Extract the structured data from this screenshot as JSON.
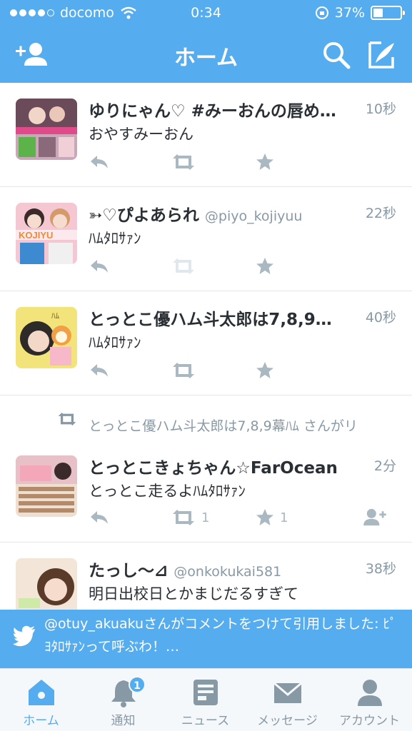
{
  "status_bar": {
    "carrier": "docomo",
    "time": "0:34",
    "battery": "37%",
    "battery_level": 0.37
  },
  "nav": {
    "title": "ホーム",
    "left_icon": "add-user-icon",
    "right_icons": [
      "search-icon",
      "compose-icon"
    ]
  },
  "tweets": [
    {
      "name": "ゆりにゃん♡ #みーおんの唇め…",
      "handle": "",
      "time": "10秒",
      "text": "おやすみーおん",
      "retweet_count": "",
      "favorite_count": ""
    },
    {
      "name": "➳♡ぴよあられ",
      "handle": "@piyo_kojiyuu",
      "time": "22秒",
      "text": "ﾊﾑﾀﾛｻｧﾝ",
      "retweet_count": "",
      "favorite_count": ""
    },
    {
      "name": "とっとこ優ハム斗太郎は7,8,9…",
      "handle": "",
      "time": "40秒",
      "text": "ﾊﾑﾀﾛｻｧﾝ",
      "retweet_count": "",
      "favorite_count": ""
    },
    {
      "retweeted_by": "とっとこ優ハム斗太郎は7,8,9幕ﾊﾑ さんがリ",
      "name": "とっとこきょちゃん☆FarOcean",
      "handle": "",
      "time": "2分",
      "text": "とっとこ走るよﾊﾑﾀﾛｻｧﾝ",
      "retweet_count": "1",
      "favorite_count": "1"
    },
    {
      "name": "たっし〜⊿",
      "handle": "@onkokukai581",
      "time": "38秒",
      "text": "明日出校日とかまじだるすぎて"
    }
  ],
  "banner": {
    "text": "@otuy_akuakuさんがコメントをつけて引用しました: ﾋﾟﾖﾀﾛｻｧﾝって呼ぶわ！…",
    "icon": "twitter-bird-icon"
  },
  "tabs": [
    {
      "label": "ホーム",
      "icon": "home-icon",
      "active": true
    },
    {
      "label": "通知",
      "icon": "notification-bell-icon",
      "badge": "1"
    },
    {
      "label": "ニュース",
      "icon": "news-icon"
    },
    {
      "label": "メッセージ",
      "icon": "message-envelope-icon"
    },
    {
      "label": "アカウント",
      "icon": "account-icon"
    }
  ],
  "colors": {
    "brand": "#55acee",
    "muted": "#8899a6",
    "action": "#aab8c2"
  }
}
